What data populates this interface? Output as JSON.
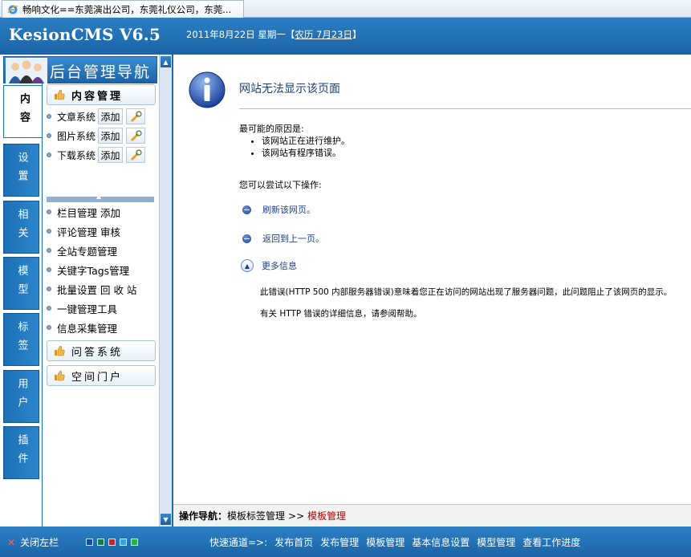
{
  "browser": {
    "tab_title": "畅响文化==东莞演出公司，东莞礼仪公司，东莞..."
  },
  "header": {
    "brand": "KesionCMS V6.5",
    "date_prefix": "2011年8月22日 星期一【",
    "lunar": "农历 7月23日",
    "date_suffix": "】"
  },
  "left_nav": {
    "title": "后台管理导航",
    "tabs": [
      {
        "label": "内容",
        "active": true
      },
      {
        "label": "设置",
        "active": false
      },
      {
        "label": "相关",
        "active": false
      },
      {
        "label": "模型",
        "active": false
      },
      {
        "label": "标签",
        "active": false
      },
      {
        "label": "用户",
        "active": false
      },
      {
        "label": "插件",
        "active": false
      }
    ],
    "content_group": "内容管理",
    "systems": [
      {
        "label": "文章系统",
        "add": "添加"
      },
      {
        "label": "图片系统",
        "add": "添加"
      },
      {
        "label": "下载系统",
        "add": "添加"
      }
    ],
    "items": [
      "栏目管理 添加",
      "评论管理 审核",
      "全站专题管理",
      "关键字Tags管理",
      "批量设置 回 收 站",
      "一键管理工具",
      "信息采集管理"
    ],
    "groups": [
      "问答系统",
      "空间门户"
    ]
  },
  "error_page": {
    "title": "网站无法显示该页面",
    "reason_heading": "最可能的原因是:",
    "reasons": [
      "该网站正在进行维护。",
      "该网站有程序错误。"
    ],
    "try_heading": "您可以尝试以下操作:",
    "actions": [
      "刷新该网页。",
      "返回到上一页。"
    ],
    "more_info": "更多信息",
    "detail": "此错误(HTTP 500 内部服务器错误)意味着您正在访问的网站出现了服务器问题，此问题阻止了该网页的显示。",
    "help": "有关 HTTP 错误的详细信息，请参阅帮助。"
  },
  "breadcrumb": {
    "label": "操作导航：",
    "parent": "模板标签管理",
    "separator": ">>",
    "current": "模板管理"
  },
  "footer": {
    "close_left": "关闭左栏",
    "swatch_colors": [
      "#1a4aa0",
      "#1f7a4a",
      "#b03030",
      "#3aa0e0",
      "#2bb040"
    ],
    "quick_label": "快速通道=>:",
    "quick_links": [
      "发布首页",
      "发布管理",
      "模板管理",
      "基本信息设置",
      "模型管理",
      "查看工作进度"
    ]
  }
}
